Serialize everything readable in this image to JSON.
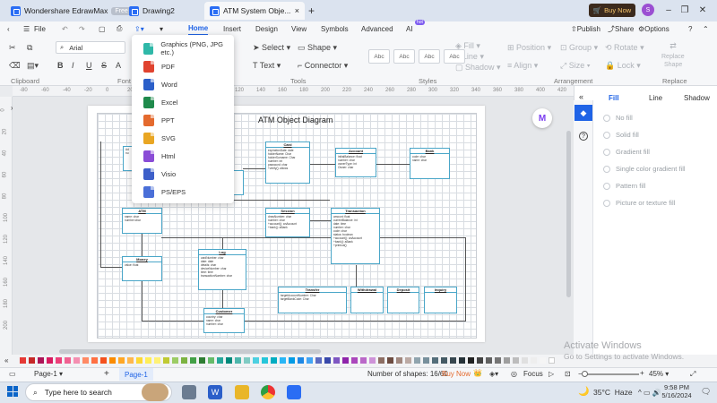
{
  "titlebar": {
    "tabs": [
      {
        "label": "Wondershare EdrawMax",
        "badge": "Free"
      },
      {
        "label": "Drawing2"
      },
      {
        "label": "ATM System Obje..."
      }
    ],
    "new_tab": "+",
    "buy_now": "Buy Now",
    "avatar_letter": "S"
  },
  "menubar": {
    "file": "File",
    "items": [
      "Home",
      "Insert",
      "Design",
      "View",
      "Symbols",
      "Advanced",
      "AI"
    ],
    "ai_badge": "hot",
    "active": "Home",
    "right": {
      "publish": "Publish",
      "share": "Share",
      "options": "Options"
    }
  },
  "ribbon": {
    "font_name": "Arial",
    "groups": [
      "Clipboard",
      "Font",
      "Tools",
      "Styles",
      "Arrangement",
      "Replace"
    ],
    "tools": {
      "select": "Select",
      "shape": "Shape",
      "text": "Text",
      "connector": "Connector"
    },
    "styles": [
      "Abc",
      "Abc",
      "Abc",
      "Abc"
    ],
    "right_tools": {
      "fill": "Fill",
      "line": "Line",
      "shadow": "Shadow",
      "position": "Position",
      "group": "Group",
      "rotate": "Rotate",
      "align": "Align",
      "size": "Size",
      "lock": "Lock",
      "replace": "Replace",
      "shape": "Shape"
    }
  },
  "ruler_ticks": [
    "-80",
    "-60",
    "-40",
    "-20",
    "0",
    "20",
    "40",
    "60",
    "80",
    "100",
    "120",
    "140",
    "160",
    "180",
    "200",
    "220",
    "240",
    "260",
    "280",
    "300",
    "320",
    "340",
    "360",
    "380",
    "400",
    "420"
  ],
  "vruler_ticks": [
    "0",
    "20",
    "40",
    "60",
    "80",
    "100",
    "120",
    "140",
    "160",
    "180",
    "200"
  ],
  "export_menu": {
    "items": [
      {
        "label": "Graphics (PNG, JPG etc.)",
        "color": "#2fb8a8"
      },
      {
        "label": "PDF",
        "color": "#e0432f"
      },
      {
        "label": "Word",
        "color": "#2b5fc9"
      },
      {
        "label": "Excel",
        "color": "#1f8a4c"
      },
      {
        "label": "PPT",
        "color": "#e46a2e"
      },
      {
        "label": "SVG",
        "color": "#e9a623"
      },
      {
        "label": "Html",
        "color": "#8a4cd6"
      },
      {
        "label": "Visio",
        "color": "#3d5fc9"
      },
      {
        "label": "PS/EPS",
        "color": "#4a6fd8"
      }
    ]
  },
  "diagram": {
    "title": "ATM Object Diagram",
    "classes": {
      "card": {
        "name": "Card",
        "body": "expirationDate: date\nholderName: Char\nholderSurname: Char\nnumber: int\npassword: char\n+verify(): allows"
      },
      "account": {
        "name": "Account",
        "body": "initialBalance: float\nnumber: char\nownerType: int\nOwner: char"
      },
      "bank": {
        "name": "Bank",
        "body": "code: char\nname: char"
      },
      "atm": {
        "name": "ATM",
        "body": "name: char\nnumber:char"
      },
      "session": {
        "name": "Session",
        "body": "drawNumber: char\nnumber: char\n+account(): anAccount\n+bank(): aBank"
      },
      "transaction": {
        "name": "Transaction",
        "body": "amount: float\ncurrentBalance: int\ndate: time\nnumber: char\ncode: char\nstatus: boolean\n+account(): anAccount\n+bank(): aBank\n+printout()"
      },
      "money": {
        "name": "Money",
        "body": "value: float"
      },
      "log": {
        "name": "Log",
        "body": "cardNumber: char\ndate: date\ndetails: char\ndeviceNumber: char\ntime: time\ntransactionNumber: char"
      },
      "transfer": {
        "name": "Transfer",
        "body": "targetAccountNumber: Char\ntargetBankCode: Char"
      },
      "withdrawal": {
        "name": "Withdrawal",
        "body": ""
      },
      "deposit": {
        "name": "Deposit",
        "body": ""
      },
      "inquiry": {
        "name": "Inquiry",
        "body": ""
      },
      "customer": {
        "name": "Customer",
        "body": "country: char\nname: char\nnumber: char"
      },
      "partial": {
        "name": "",
        "body": "Ad\nnu"
      }
    }
  },
  "right_panel": {
    "tabs": [
      "Fill",
      "Line",
      "Shadow"
    ],
    "active": "Fill",
    "options": [
      "No fill",
      "Solid fill",
      "Gradient fill",
      "Single color gradient fill",
      "Pattern fill",
      "Picture or texture fill"
    ]
  },
  "color_palette": [
    "#e53935",
    "#c62828",
    "#ad1457",
    "#d81b60",
    "#ec407a",
    "#f06292",
    "#f48fb1",
    "#ff8a65",
    "#ff7043",
    "#f4511e",
    "#fb8c00",
    "#ffa726",
    "#ffb74d",
    "#fdd835",
    "#ffee58",
    "#fff176",
    "#c0ca33",
    "#9ccc65",
    "#7cb342",
    "#43a047",
    "#2e7d32",
    "#66bb6a",
    "#26a69a",
    "#00897b",
    "#4db6ac",
    "#80cbc4",
    "#4dd0e1",
    "#26c6da",
    "#00acc1",
    "#29b6f6",
    "#039be5",
    "#1e88e5",
    "#42a5f5",
    "#5c6bc0",
    "#3949ab",
    "#7e57c2",
    "#8e24aa",
    "#ab47bc",
    "#ba68c8",
    "#ce93d8",
    "#8d6e63",
    "#6d4c41",
    "#a1887f",
    "#bcaaa4",
    "#90a4ae",
    "#78909c",
    "#546e7a",
    "#455a64",
    "#37474f",
    "#263238",
    "#212121",
    "#424242",
    "#616161",
    "#757575",
    "#9e9e9e",
    "#bdbdbd",
    "#e0e0e0",
    "#eeeeee",
    "#f5f5f5",
    "#ffffff"
  ],
  "status": {
    "page_selector": "Page-1",
    "add_page": "+",
    "page_tab": "Page-1",
    "shapes_label": "Number of shapes: 16/60",
    "buy_now": "Buy Now",
    "focus": "Focus",
    "zoom": "45%"
  },
  "watermark": {
    "line1": "Activate Windows",
    "line2": "Go to Settings to activate Windows."
  },
  "taskbar": {
    "search_placeholder": "Type here to search",
    "weather": "35°C  Haze",
    "time": "9:58 PM",
    "date": "5/16/2024"
  }
}
